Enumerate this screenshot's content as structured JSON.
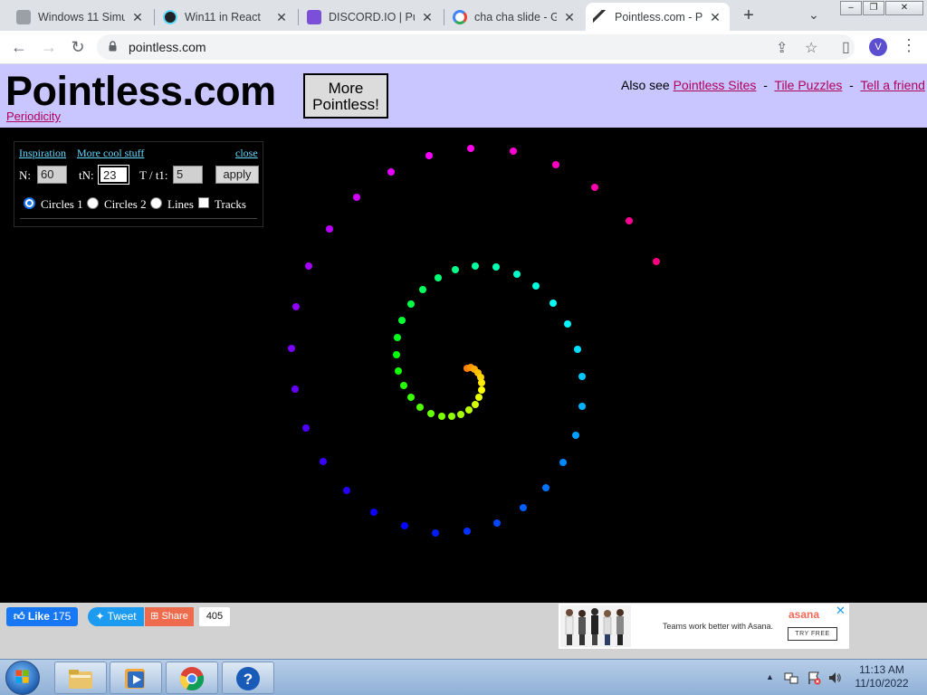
{
  "browser": {
    "tabs": [
      {
        "title": "Windows 11 Simu",
        "favicon_color": "#9aa0a6",
        "active": false
      },
      {
        "title": "Win11 in React",
        "favicon_color": "#202124",
        "active": false
      },
      {
        "title": "DISCORD.IO | Pub",
        "favicon_color": "#7b4fd8",
        "active": false
      },
      {
        "title": "cha cha slide - Go",
        "favicon_color": "#4285f4",
        "active": false
      },
      {
        "title": "Pointless.com - Pe",
        "favicon_color": "#333333",
        "active": true
      }
    ],
    "close_glyph": "✕",
    "new_tab_glyph": "+",
    "tab_dropdown_glyph": "⌄",
    "window_controls": {
      "minimize": "–",
      "maximize": "❐",
      "close": "✕"
    },
    "nav": {
      "back": "←",
      "forward": "→",
      "reload": "↻"
    },
    "url": "pointless.com",
    "share_icon": "⇪",
    "star_icon": "☆",
    "sidepanel_icon": "▯",
    "profile_initial": "V",
    "menu_icon": "⋮"
  },
  "site": {
    "logo": "Pointless.com",
    "more_button_line1": "More",
    "more_button_line2": "Pointless!",
    "periodicity": "Periodicity",
    "also_see": "Also see",
    "links": [
      "Pointless Sites",
      "Tile Puzzles",
      "Tell a friend"
    ],
    "sep": "-"
  },
  "panel": {
    "inspiration": "Inspiration",
    "more_cool_stuff": "More cool stuff",
    "close": "close",
    "n_label": "N:",
    "n_value": "60",
    "tn_label": "tN:",
    "tn_value": "23",
    "ratio_label": "T / t1:",
    "ratio_value": "5",
    "apply": "apply",
    "options": [
      {
        "label": "Circles 1",
        "kind": "radio",
        "selected": true
      },
      {
        "label": "Circles 2",
        "kind": "radio",
        "selected": false
      },
      {
        "label": "Lines",
        "kind": "radio",
        "selected": false
      },
      {
        "label": "Tracks",
        "kind": "checkbox",
        "selected": false
      }
    ]
  },
  "share": {
    "like_label": "Like",
    "like_count": "175",
    "tweet_label": "Tweet",
    "share_label": "Share",
    "share_count": "405"
  },
  "ad": {
    "brand": "asana",
    "tagline": "Teams work better with Asana.",
    "cta": "TRY FREE",
    "close": "✕"
  },
  "taskbar": {
    "time": "11:13 AM",
    "date": "11/10/2022",
    "tray_arrow": "▲"
  }
}
